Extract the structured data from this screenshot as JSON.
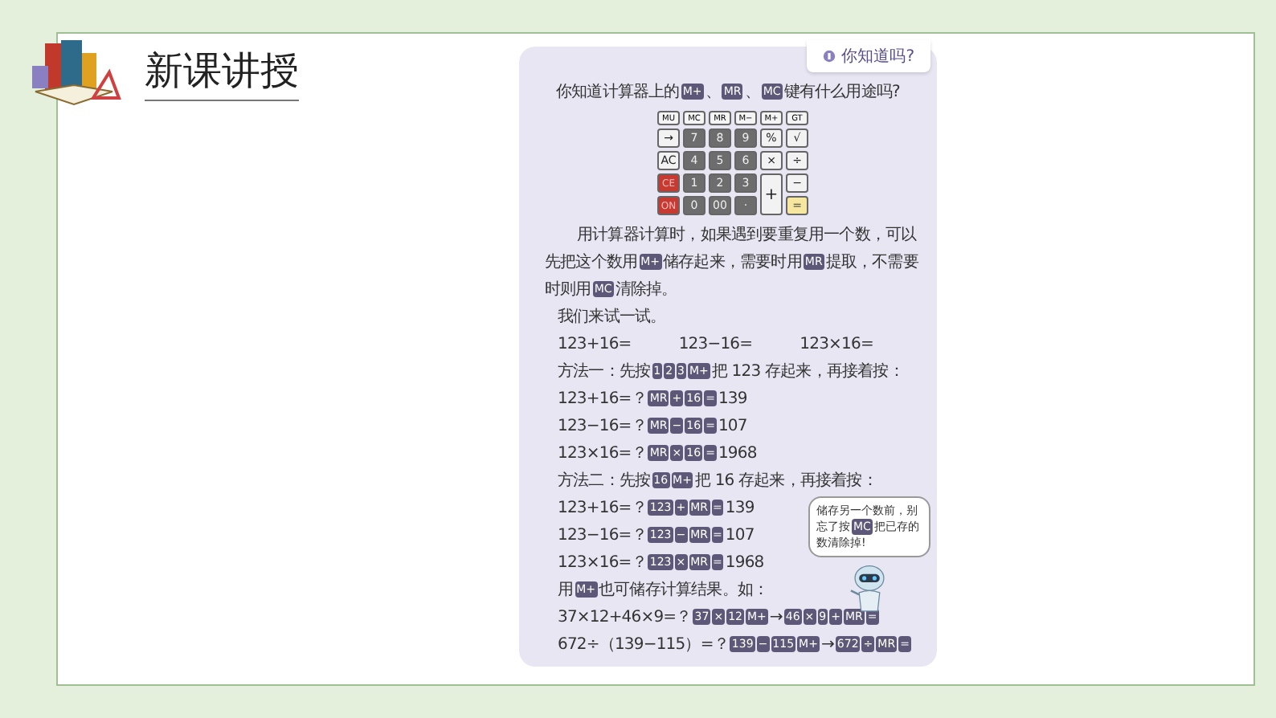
{
  "header": {
    "title": "新课讲授"
  },
  "panel": {
    "tag": "你知道吗?",
    "question": [
      {
        "kind": "text",
        "text": "你知道计算器上的"
      },
      {
        "kind": "keys",
        "keys": [
          "M+"
        ]
      },
      {
        "kind": "text",
        "text": "、"
      },
      {
        "kind": "keys",
        "keys": [
          "MR"
        ]
      },
      {
        "kind": "text",
        "text": "、"
      },
      {
        "kind": "keys",
        "keys": [
          "MC"
        ]
      },
      {
        "kind": "text",
        "text": "键有什么用途吗?"
      }
    ],
    "calculator": [
      {
        "label": "MU",
        "kind": "memory"
      },
      {
        "label": "MC",
        "kind": "memory"
      },
      {
        "label": "MR",
        "kind": "memory"
      },
      {
        "label": "M−",
        "kind": "memory"
      },
      {
        "label": "M+",
        "kind": "memory"
      },
      {
        "label": "GT",
        "kind": "memory"
      },
      {
        "label": "→",
        "kind": "light"
      },
      {
        "label": "7",
        "kind": "dark"
      },
      {
        "label": "8",
        "kind": "dark"
      },
      {
        "label": "9",
        "kind": "dark"
      },
      {
        "label": "%",
        "kind": "light"
      },
      {
        "label": "√",
        "kind": "light"
      },
      {
        "label": "AC",
        "kind": "light"
      },
      {
        "label": "4",
        "kind": "dark"
      },
      {
        "label": "5",
        "kind": "dark"
      },
      {
        "label": "6",
        "kind": "dark"
      },
      {
        "label": "×",
        "kind": "light"
      },
      {
        "label": "÷",
        "kind": "light"
      },
      {
        "label": "CE",
        "kind": "red"
      },
      {
        "label": "1",
        "kind": "dark"
      },
      {
        "label": "2",
        "kind": "dark"
      },
      {
        "label": "3",
        "kind": "dark"
      },
      {
        "label": "+",
        "kind": "tall"
      },
      {
        "label": "−",
        "kind": "light"
      },
      {
        "label": "ON",
        "kind": "red"
      },
      {
        "label": "0",
        "kind": "dark"
      },
      {
        "label": "00",
        "kind": "dark"
      },
      {
        "label": "·",
        "kind": "dark"
      },
      {
        "label": "=",
        "kind": "yellow"
      }
    ],
    "lines": [
      {
        "kind": "para",
        "segments": [
          {
            "kind": "text",
            "text": "用计算器计算时，如果遇到要重复用一个数，可以先把这个数用"
          },
          {
            "kind": "keys",
            "keys": [
              "M+"
            ]
          },
          {
            "kind": "text",
            "text": "储存起来，需要时用"
          },
          {
            "kind": "keys",
            "keys": [
              "MR"
            ]
          },
          {
            "kind": "text",
            "text": "提取，不需要时则用"
          },
          {
            "kind": "keys",
            "keys": [
              "MC"
            ]
          },
          {
            "kind": "text",
            "text": "清除掉。"
          }
        ]
      },
      {
        "kind": "indent",
        "segments": [
          {
            "kind": "text",
            "text": "我们来试一试。"
          }
        ]
      },
      {
        "kind": "columns",
        "segments": [
          {
            "kind": "text",
            "text": "123+16="
          },
          {
            "kind": "text",
            "text": "123−16="
          },
          {
            "kind": "text",
            "text": "123×16="
          }
        ]
      },
      {
        "kind": "indent",
        "segments": [
          {
            "kind": "text",
            "text": "方法一：先按"
          },
          {
            "kind": "keys",
            "keys": [
              "1",
              "2",
              "3",
              "M+"
            ]
          },
          {
            "kind": "text",
            "text": "把 123 存起来，再接着按："
          }
        ]
      },
      {
        "kind": "indent",
        "segments": [
          {
            "kind": "text",
            "text": "123+16=？"
          },
          {
            "kind": "keys",
            "keys": [
              "MR",
              "+",
              "16",
              "="
            ]
          },
          {
            "kind": "text",
            "text": "139"
          }
        ]
      },
      {
        "kind": "indent",
        "segments": [
          {
            "kind": "text",
            "text": "123−16=？"
          },
          {
            "kind": "keys",
            "keys": [
              "MR",
              "−",
              "16",
              "="
            ]
          },
          {
            "kind": "text",
            "text": "107"
          }
        ]
      },
      {
        "kind": "indent",
        "segments": [
          {
            "kind": "text",
            "text": "123×16=？"
          },
          {
            "kind": "keys",
            "keys": [
              "MR",
              "×",
              "16",
              "="
            ]
          },
          {
            "kind": "text",
            "text": "1968"
          }
        ]
      },
      {
        "kind": "indent",
        "segments": [
          {
            "kind": "text",
            "text": "方法二：先按"
          },
          {
            "kind": "keys",
            "keys": [
              "16",
              "M+"
            ]
          },
          {
            "kind": "text",
            "text": "把 16 存起来，再接着按："
          }
        ]
      },
      {
        "kind": "indent",
        "segments": [
          {
            "kind": "text",
            "text": "123+16=？"
          },
          {
            "kind": "keys",
            "keys": [
              "123",
              "+",
              "MR",
              "="
            ]
          },
          {
            "kind": "text",
            "text": "139"
          }
        ]
      },
      {
        "kind": "indent",
        "segments": [
          {
            "kind": "text",
            "text": "123−16=？"
          },
          {
            "kind": "keys",
            "keys": [
              "123",
              "−",
              "MR",
              "="
            ]
          },
          {
            "kind": "text",
            "text": "107"
          }
        ]
      },
      {
        "kind": "indent",
        "segments": [
          {
            "kind": "text",
            "text": "123×16=？"
          },
          {
            "kind": "keys",
            "keys": [
              "123",
              "×",
              "MR",
              "="
            ]
          },
          {
            "kind": "text",
            "text": "1968"
          }
        ]
      },
      {
        "kind": "indent",
        "segments": [
          {
            "kind": "text",
            "text": "用"
          },
          {
            "kind": "keys",
            "keys": [
              "M+"
            ]
          },
          {
            "kind": "text",
            "text": "也可储存计算结果。如："
          }
        ]
      },
      {
        "kind": "indent",
        "segments": [
          {
            "kind": "text",
            "text": "37×12+46×9=？"
          },
          {
            "kind": "keys",
            "keys": [
              "37",
              "×",
              "12",
              "M+"
            ]
          },
          {
            "kind": "text",
            "text": "→"
          },
          {
            "kind": "keys",
            "keys": [
              "46",
              "×",
              "9",
              "+",
              "MR",
              "="
            ]
          }
        ]
      },
      {
        "kind": "indent",
        "segments": [
          {
            "kind": "text",
            "text": "672÷（139−115）=？"
          },
          {
            "kind": "keys",
            "keys": [
              "139",
              "−",
              "115",
              "M+"
            ]
          },
          {
            "kind": "text",
            "text": "→"
          },
          {
            "kind": "keys",
            "keys": [
              "672",
              "÷",
              "MR",
              "="
            ]
          }
        ]
      }
    ],
    "bubble": [
      {
        "kind": "text",
        "text": "储存另一个数前，别忘了按"
      },
      {
        "kind": "keys",
        "keys": [
          "MC"
        ]
      },
      {
        "kind": "text",
        "text": "把已存的数清除掉!"
      }
    ]
  }
}
